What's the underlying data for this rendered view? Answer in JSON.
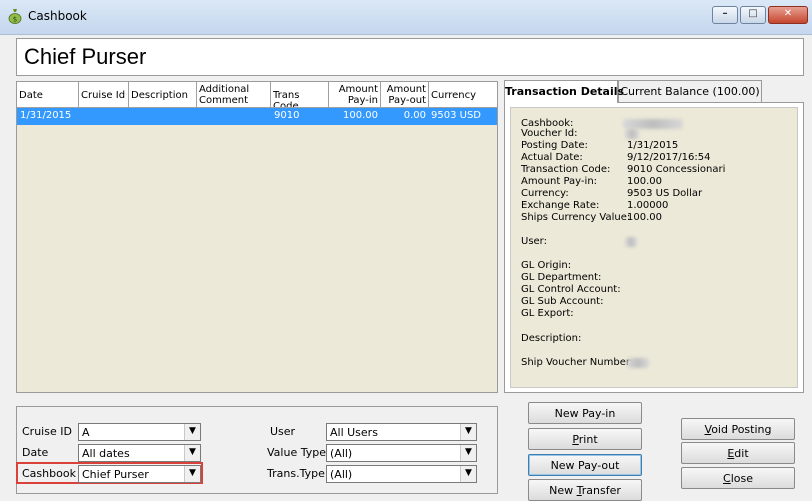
{
  "window": {
    "title": "Cashbook",
    "icon": "money-bag-icon",
    "controls": {
      "minimize": "–",
      "maximize": "□",
      "close": "✕"
    }
  },
  "header": {
    "title": "Chief Purser"
  },
  "grid": {
    "columns": [
      {
        "label": "Date"
      },
      {
        "label": "Cruise Id"
      },
      {
        "label": "Description"
      },
      {
        "label": "Additional Comment"
      },
      {
        "label": "Trans Code"
      },
      {
        "label": "Amount Pay-in"
      },
      {
        "label": "Amount Pay-out"
      },
      {
        "label": "Currency"
      }
    ],
    "rows": [
      {
        "date": "1/31/2015",
        "cruise_id": "",
        "description": "",
        "comment": "",
        "trans_code": "9010",
        "pay_in": "100.00",
        "pay_out": "0.00",
        "currency": "9503 USD"
      }
    ],
    "selected_row_color": "#3399ff"
  },
  "tabs": [
    {
      "label": "Transaction Details",
      "active": true
    },
    {
      "label": "Current Balance (100.00)",
      "active": false
    }
  ],
  "details": {
    "cashbook": {
      "label": "Cashbook:",
      "value": ""
    },
    "voucher_id": {
      "label": "Voucher Id:",
      "value": ""
    },
    "posting_date": {
      "label": "Posting Date:",
      "value": "1/31/2015"
    },
    "actual_date": {
      "label": "Actual Date:",
      "value": "9/12/2017/16:54"
    },
    "trans_code": {
      "label": "Transaction Code:",
      "value": "9010  Concessionari"
    },
    "amount_pay_in": {
      "label": "Amount Pay-in:",
      "value": "100.00"
    },
    "currency": {
      "label": "Currency:",
      "value": "9503 US Dollar"
    },
    "exchange_rate": {
      "label": "Exchange Rate:",
      "value": "1.00000"
    },
    "ships_currency_value": {
      "label": "Ships Currency Value:",
      "value": "100.00"
    },
    "user": {
      "label": "User:",
      "value": ""
    },
    "gl_origin": {
      "label": "GL Origin:"
    },
    "gl_department": {
      "label": "GL Department:"
    },
    "gl_control": {
      "label": "GL Control Account:"
    },
    "gl_sub": {
      "label": "GL Sub Account:"
    },
    "gl_export": {
      "label": "GL Export:"
    },
    "description": {
      "label": "Description:"
    },
    "ship_voucher": {
      "label": "Ship Voucher Number:",
      "value": ""
    }
  },
  "filters": {
    "cruise_id": {
      "label": "Cruise ID",
      "value": "A"
    },
    "date": {
      "label": "Date",
      "value": "All dates"
    },
    "cashbook": {
      "label": "Cashbook",
      "value": "Chief Purser"
    },
    "user": {
      "label": "User",
      "value": "All Users"
    },
    "value_type": {
      "label": "Value Type",
      "value": "(All)"
    },
    "trans_type": {
      "label": "Trans.Type",
      "value": "(All)"
    }
  },
  "buttons": {
    "new_pay_in": "New Pay-in",
    "print": {
      "pre": "",
      "u": "P",
      "post": "rint"
    },
    "new_pay_out": "New Pay-out",
    "new_transfer": {
      "pre": "New ",
      "u": "T",
      "post": "ransfer"
    },
    "void_posting": {
      "pre": "",
      "u": "V",
      "post": "oid Posting"
    },
    "edit": {
      "pre": "",
      "u": "E",
      "post": "dit"
    },
    "close": {
      "pre": "",
      "u": "C",
      "post": "lose"
    }
  },
  "highlight_color": "#d9413a",
  "dropdown_arrow": "▼"
}
